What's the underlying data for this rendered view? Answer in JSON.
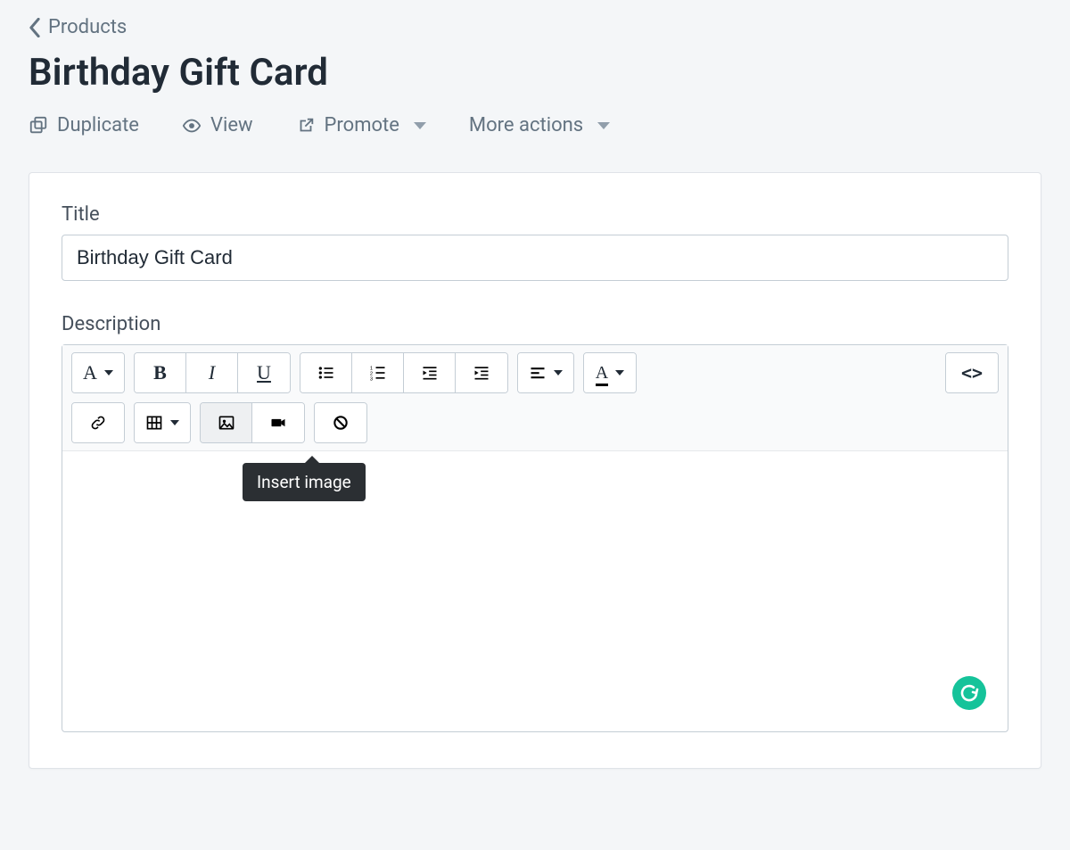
{
  "breadcrumb": {
    "label": "Products"
  },
  "page": {
    "title": "Birthday Gift Card"
  },
  "actions": {
    "duplicate": "Duplicate",
    "view": "View",
    "promote": "Promote",
    "more": "More actions"
  },
  "form": {
    "title_label": "Title",
    "title_value": "Birthday Gift Card",
    "description_label": "Description"
  },
  "toolbar": {
    "format_glyph": "A",
    "bold_glyph": "B",
    "italic_glyph": "I",
    "underline_glyph": "U",
    "color_glyph": "A",
    "code_glyph": "<>"
  },
  "tooltip": {
    "insert_image": "Insert image"
  }
}
